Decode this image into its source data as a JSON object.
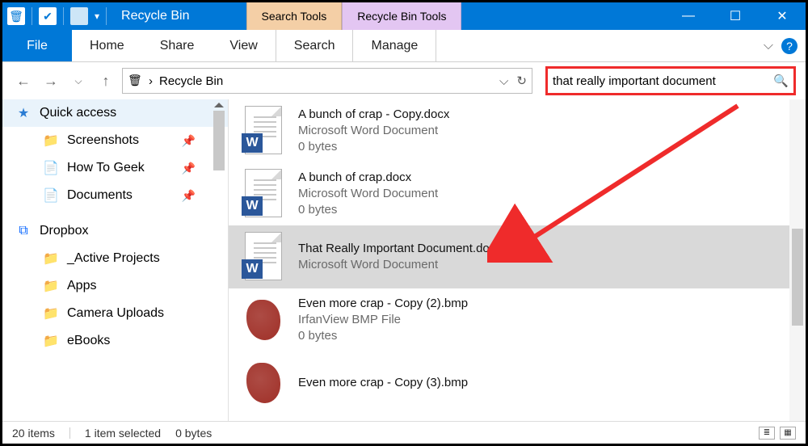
{
  "window": {
    "title": "Recycle Bin",
    "tooltab_search": "Search Tools",
    "tooltab_recycle": "Recycle Bin Tools"
  },
  "ribbon": {
    "file": "File",
    "tabs": [
      "Home",
      "Share",
      "View",
      "Search",
      "Manage"
    ]
  },
  "address": {
    "path": "Recycle Bin"
  },
  "search": {
    "value": "that really important document"
  },
  "sidebar": {
    "quick_access": "Quick access",
    "items": [
      {
        "icon": "📁",
        "label": "Screenshots",
        "pinned": true
      },
      {
        "icon": "📄",
        "label": "How To Geek",
        "pinned": true,
        "overlay": "✔"
      },
      {
        "icon": "📄",
        "label": "Documents",
        "pinned": true
      }
    ],
    "dropbox": "Dropbox",
    "db_items": [
      {
        "icon": "📁",
        "label": "_Active Projects",
        "overlay": "✔"
      },
      {
        "icon": "📁",
        "label": "Apps",
        "overlay": "✔"
      },
      {
        "icon": "📁",
        "label": "Camera Uploads",
        "overlay": "📷"
      },
      {
        "icon": "📁",
        "label": "eBooks",
        "overlay": "✔"
      }
    ]
  },
  "files": [
    {
      "name": "A bunch of crap - Copy.docx",
      "type": "Microsoft Word Document",
      "size": "0 bytes",
      "kind": "word"
    },
    {
      "name": "A bunch of crap.docx",
      "type": "Microsoft Word Document",
      "size": "0 bytes",
      "kind": "word"
    },
    {
      "name": "That Really Important Document.docx",
      "type": "Microsoft Word Document",
      "size": "",
      "kind": "word",
      "selected": true
    },
    {
      "name": "Even more crap - Copy (2).bmp",
      "type": "IrfanView BMP File",
      "size": "0 bytes",
      "kind": "bmp"
    },
    {
      "name": "Even more crap - Copy (3).bmp",
      "type": "",
      "size": "",
      "kind": "bmp"
    }
  ],
  "status": {
    "count": "20 items",
    "selected": "1 item selected",
    "size": "0 bytes"
  }
}
